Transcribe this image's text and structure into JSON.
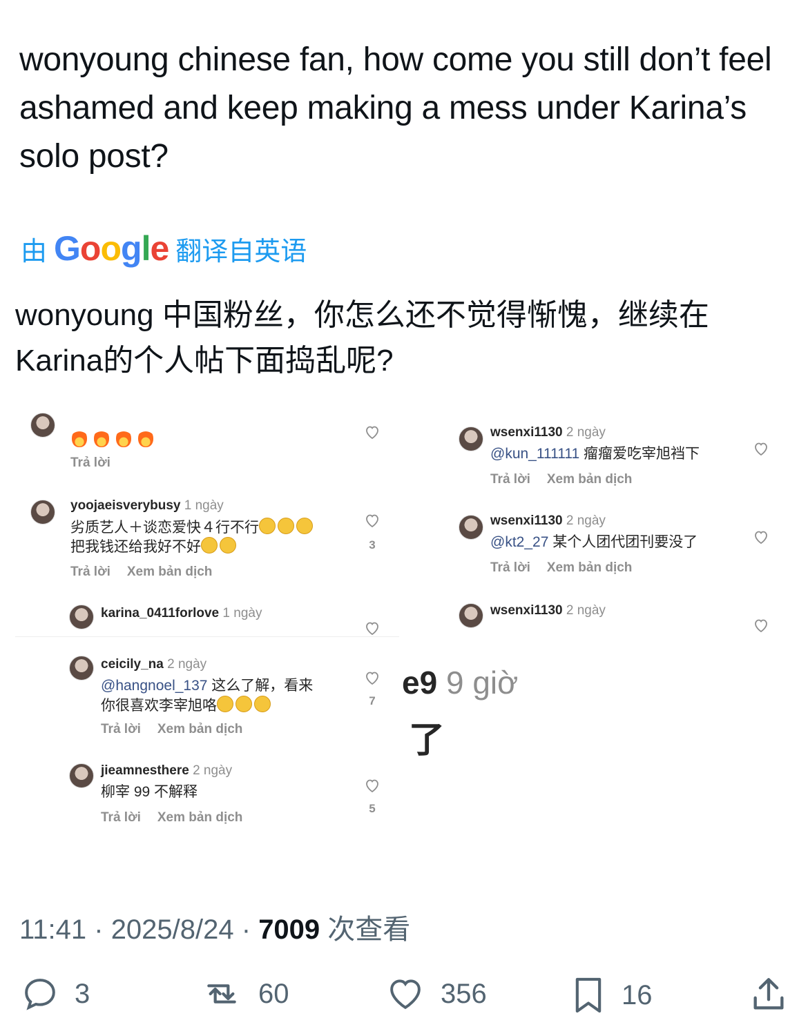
{
  "tweet": {
    "text": "wonyoung chinese fan, how come you still don’t feel ashamed and keep making a mess under Karina’s solo post?",
    "translate_prefix": "由",
    "translate_brand": "Google",
    "translate_suffix": "翻译自英语",
    "translated_text": "wonyoung 中国粉丝，你怎么还不觉得惭愧，继续在 Karina的个人帖下面捣乱呢?"
  },
  "screenshot": {
    "left_panel": {
      "reply_label": "Trả lời",
      "translate_label": "Xem bản dịch",
      "comments": [
        {
          "user": "",
          "time": "",
          "text": "🔥🔥🔥🔥",
          "likes": ""
        },
        {
          "user": "yoojaeisverybusy",
          "time": "1 ngày",
          "text_line1": "劣质艺人＋谈恋爱快４行不行",
          "text_line2": "把我钱还给我好不好",
          "likes": "3"
        },
        {
          "user": "karina_0411forlove",
          "time": "1 ngày",
          "text": "",
          "likes": ""
        },
        {
          "user": "ceicily_na",
          "time": "2 ngày",
          "mention": "@hangnoel_137",
          "text_line1": " 这么了解，看来",
          "text_line2": "你很喜欢李宰旭咯",
          "likes": "7"
        },
        {
          "user": "jieamnesthere",
          "time": "2 ngày",
          "text": "柳宰 99 不解释",
          "likes": "5"
        }
      ]
    },
    "right_panel": {
      "reply_label": "Trả lời",
      "translate_label": "Xem bản dịch",
      "comments": [
        {
          "user": "wsenxi1130",
          "time": "2 ngày",
          "mention": "@kun_111111",
          "text": " 瘤瘤爱吃宰旭裆下"
        },
        {
          "user": "wsenxi1130",
          "time": "2 ngày",
          "mention": "@kt2_27",
          "text": " 某个人团代团刊要没了"
        },
        {
          "user": "wsenxi1130",
          "time": "2 ngày",
          "mention": "",
          "text": ""
        }
      ],
      "overlay_time": "9 giờ",
      "overlay_prefix": "e9",
      "overlay_char": "了"
    }
  },
  "meta": {
    "time": "11:41",
    "date": "2025/8/24",
    "views": "7009",
    "views_label": "次查看"
  },
  "actions": {
    "replies": "3",
    "retweets": "60",
    "likes": "356",
    "bookmarks": "16"
  }
}
